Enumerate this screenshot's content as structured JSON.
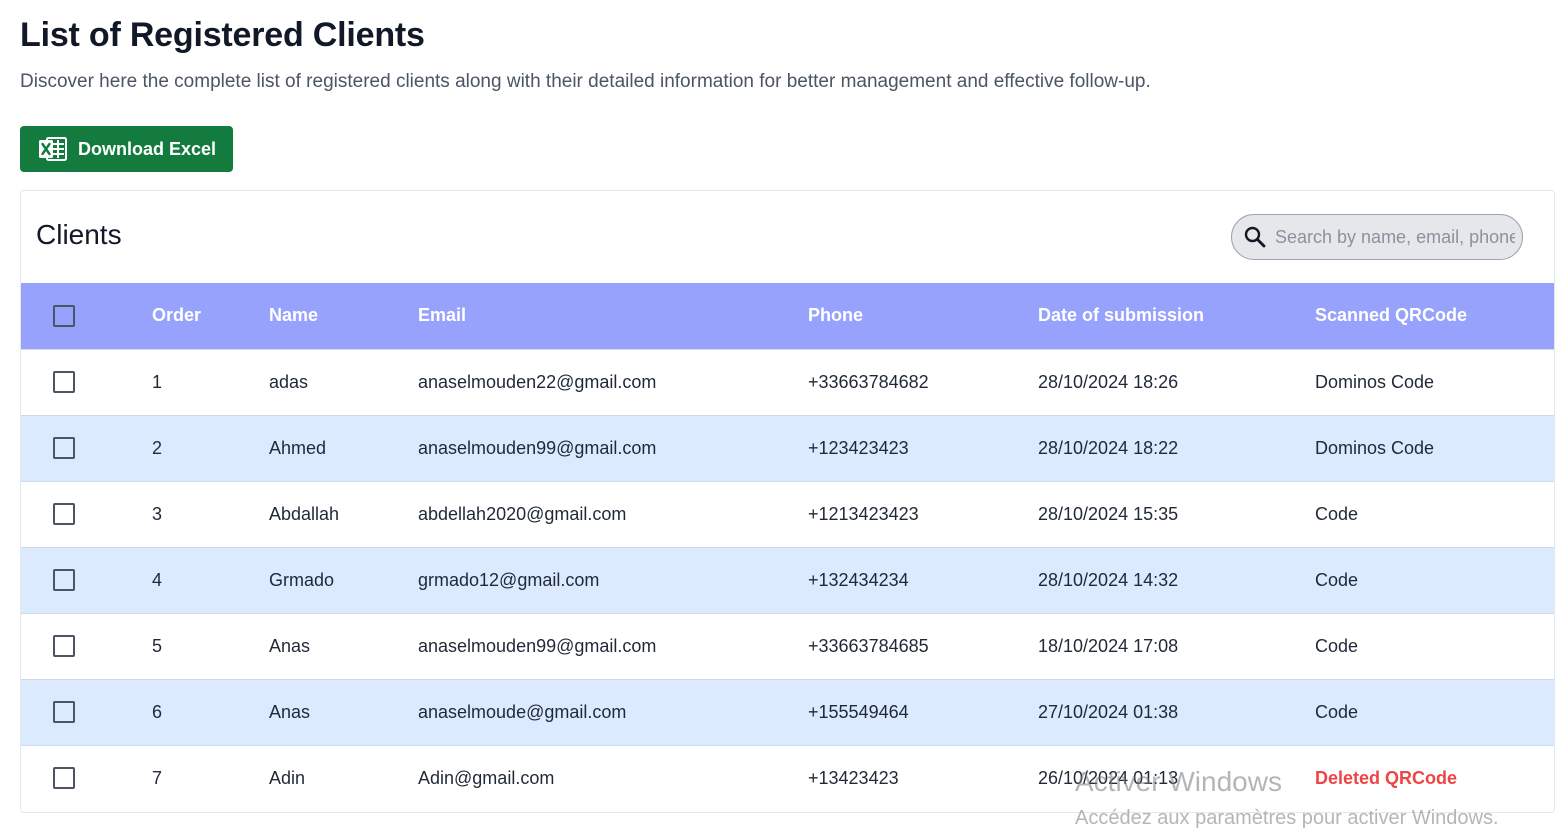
{
  "header": {
    "title": "List of Registered Clients",
    "subtitle": "Discover here the complete list of registered clients along with their detailed information for better management and effective follow-up.",
    "download_label": "Download Excel"
  },
  "card": {
    "title": "Clients",
    "search_placeholder": "Search by name, email, phone"
  },
  "table": {
    "columns": [
      "Order",
      "Name",
      "Email",
      "Phone",
      "Date of submission",
      "Scanned QRCode"
    ],
    "rows": [
      {
        "order": "1",
        "name": "adas",
        "email": "anaselmouden22@gmail.com",
        "phone": "+33663784682",
        "date": "28/10/2024 18:26",
        "qrcode": "Dominos Code"
      },
      {
        "order": "2",
        "name": "Ahmed",
        "email": "anaselmouden99@gmail.com",
        "phone": "+123423423",
        "date": "28/10/2024 18:22",
        "qrcode": "Dominos Code"
      },
      {
        "order": "3",
        "name": "Abdallah",
        "email": "abdellah2020@gmail.com",
        "phone": "+1213423423",
        "date": "28/10/2024 15:35",
        "qrcode": "Code"
      },
      {
        "order": "4",
        "name": "Grmado",
        "email": "grmado12@gmail.com",
        "phone": "+132434234",
        "date": "28/10/2024 14:32",
        "qrcode": "Code"
      },
      {
        "order": "5",
        "name": "Anas",
        "email": "anaselmouden99@gmail.com",
        "phone": "+33663784685",
        "date": "18/10/2024 17:08",
        "qrcode": "Code"
      },
      {
        "order": "6",
        "name": "Anas",
        "email": "anaselmoude@gmail.com",
        "phone": "+155549464",
        "date": "27/10/2024 01:38",
        "qrcode": "Code"
      },
      {
        "order": "7",
        "name": "Adin",
        "email": "Adin@gmail.com",
        "phone": "+13423423",
        "date": "26/10/2024 01:13",
        "qrcode": "Deleted QRCode"
      }
    ]
  },
  "colors": {
    "download_button": "#137b3d",
    "header_row": "#96a2fb",
    "alt_row": "#dbeafe",
    "deleted_text": "#ef4444"
  },
  "icons": {
    "download": "excel-icon",
    "search": "search-icon"
  },
  "watermark": {
    "line1": "Activer Windows",
    "line2": "Accédez aux paramètres pour activer Windows."
  }
}
